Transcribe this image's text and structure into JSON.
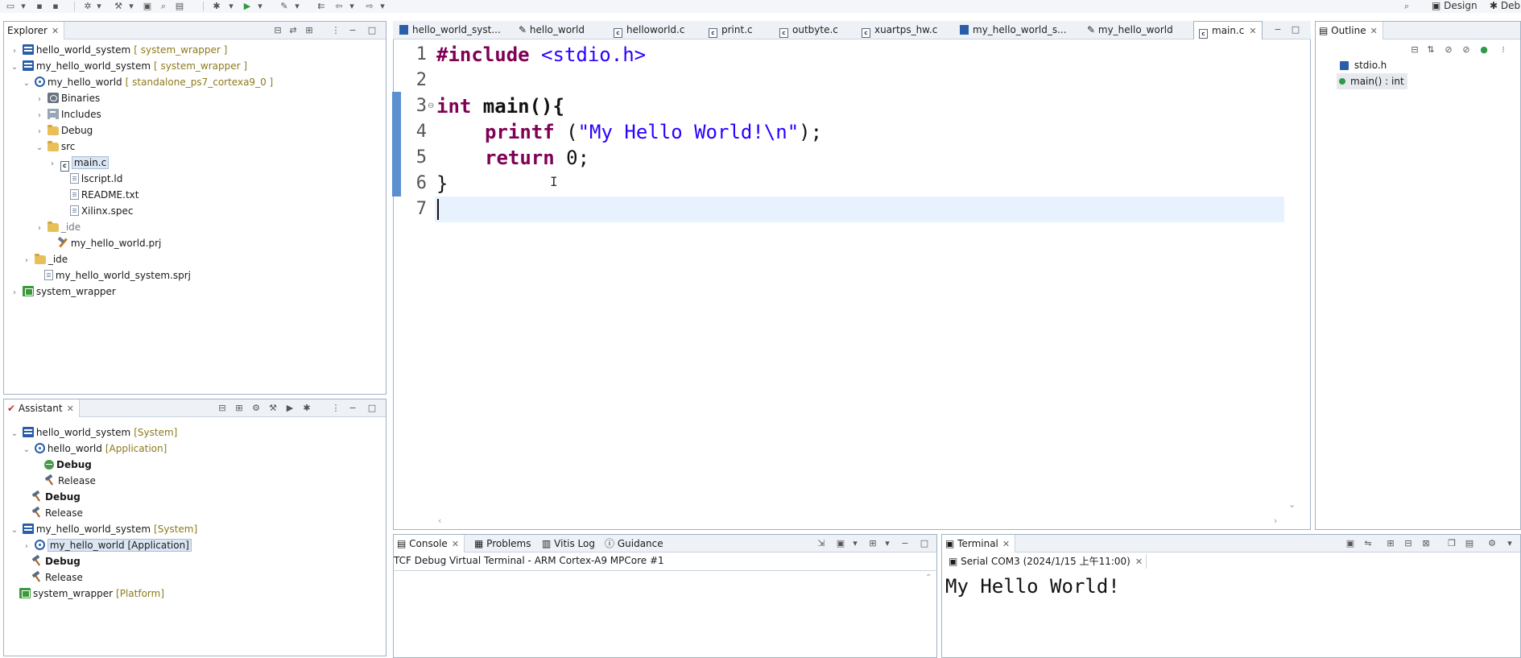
{
  "toolbar": {
    "perspectives": [
      "Design",
      "Deb"
    ]
  },
  "explorer": {
    "tab_label": "Explorer",
    "rows": [
      {
        "label": "hello_world_system",
        "bracket": "[ system_wrapper ]"
      },
      {
        "label": "my_hello_world_system",
        "bracket": "[ system_wrapper ]"
      },
      {
        "label": "my_hello_world",
        "bracket": "[ standalone_ps7_cortexa9_0 ]"
      },
      {
        "label": "Binaries"
      },
      {
        "label": "Includes"
      },
      {
        "label": "Debug"
      },
      {
        "label": "src"
      },
      {
        "label": "main.c"
      },
      {
        "label": "lscript.ld"
      },
      {
        "label": "README.txt"
      },
      {
        "label": "Xilinx.spec"
      },
      {
        "label": "_ide"
      },
      {
        "label": "my_hello_world.prj"
      },
      {
        "label": "_ide"
      },
      {
        "label": "my_hello_world_system.sprj"
      },
      {
        "label": "system_wrapper"
      }
    ]
  },
  "assistant": {
    "tab_label": "Assistant",
    "rows": [
      {
        "label": "hello_world_system",
        "bracket": "[System]"
      },
      {
        "label": "hello_world",
        "bracket": "[Application]"
      },
      {
        "label": "Debug"
      },
      {
        "label": "Release"
      },
      {
        "label": "Debug"
      },
      {
        "label": "Release"
      },
      {
        "label": "my_hello_world_system",
        "bracket": "[System]"
      },
      {
        "label": "my_hello_world [Application]"
      },
      {
        "label": "Debug"
      },
      {
        "label": "Release"
      },
      {
        "label": "system_wrapper",
        "bracket": "[Platform]"
      }
    ]
  },
  "editor": {
    "tabs": [
      "hello_world_syst...",
      "hello_world",
      "helloworld.c",
      "print.c",
      "outbyte.c",
      "xuartps_hw.c",
      "my_hello_world_s...",
      "my_hello_world",
      "main.c"
    ],
    "line_numbers": [
      "1",
      "2",
      "3",
      "4",
      "5",
      "6",
      "7"
    ],
    "code": {
      "l1_kw": "#include",
      "l1_rest": " <stdio.h>",
      "l3_kw": "int",
      "l3_rest": " main(){",
      "l4_kw": "printf",
      "l4_mid": " (",
      "l4_str": "\"My Hello World!\\n\"",
      "l4_end": ");",
      "l5_kw": "return",
      "l5_rest": " 0;",
      "l6": "}"
    }
  },
  "outline": {
    "tab_label": "Outline",
    "items": [
      "stdio.h",
      "main() : int"
    ]
  },
  "console": {
    "tabs": [
      "Console",
      "Problems",
      "Vitis Log",
      "Guidance"
    ],
    "subtitle": "TCF Debug Virtual Terminal - ARM Cortex-A9 MPCore #1"
  },
  "terminal": {
    "tab_label": "Terminal",
    "session": "Serial COM3 (2024/1/15 上午11:00)",
    "output": "My Hello World!"
  }
}
